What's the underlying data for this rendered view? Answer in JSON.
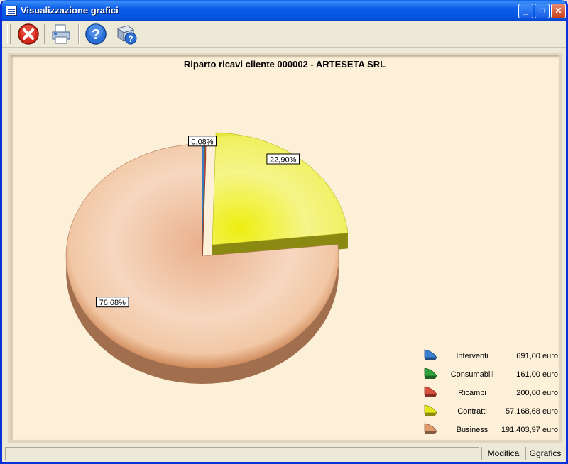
{
  "window": {
    "title": "Visualizzazione grafici"
  },
  "titlebar_buttons": {
    "minimize": "_",
    "maximize": "□",
    "close": "✕"
  },
  "toolbar": {
    "items": [
      {
        "name": "close-chart-button",
        "icon": "red-x-icon"
      },
      {
        "name": "print-button",
        "icon": "printer-icon"
      },
      {
        "name": "help-button",
        "icon": "help-icon"
      },
      {
        "name": "context-help-button",
        "icon": "help-book-icon"
      }
    ]
  },
  "chart_data": {
    "type": "pie",
    "title": "Riparto ricavi cliente 000002 - ARTESETA SRL",
    "slices": [
      {
        "label": "Interventi",
        "value": 691.0,
        "value_text": "691,00 euro",
        "percent_label": "0,08%",
        "color": "#3b7fd0"
      },
      {
        "label": "Consumabili",
        "value": 161.0,
        "value_text": "161,00 euro",
        "percent_label": "",
        "color": "#2ea23a"
      },
      {
        "label": "Ricambi",
        "value": 200.0,
        "value_text": "200,00 euro",
        "percent_label": "",
        "color": "#d9503e"
      },
      {
        "label": "Contratti",
        "value": 57168.68,
        "value_text": "57.168,68 euro",
        "percent_label": "22,90%",
        "color": "#e6e61e"
      },
      {
        "label": "Business",
        "value": 191403.97,
        "value_text": "191.403,97 euro",
        "percent_label": "76,68%",
        "color": "#e09a6c"
      }
    ],
    "legend_position": "bottom-right",
    "style": "3d-exploded"
  },
  "status": {
    "modifica": "Modifica",
    "grafics": "Ggrafics"
  }
}
